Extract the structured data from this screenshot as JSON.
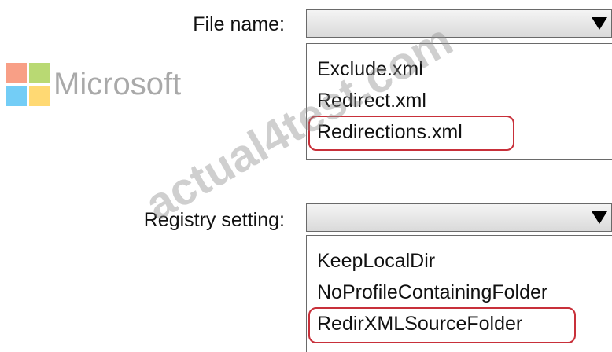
{
  "watermark": {
    "brand": "Microsoft",
    "site": "actual4test.com",
    "logo_colors": [
      "#f25022",
      "#7fba00",
      "#00a4ef",
      "#ffb900"
    ]
  },
  "file_name": {
    "label": "File name:",
    "selected_value": "",
    "arrow_icon": "triangle-down",
    "options": [
      "Exclude.xml",
      "Redirect.xml",
      "Redirections.xml"
    ],
    "highlighted_option": "Redirections.xml"
  },
  "registry_setting": {
    "label": "Registry setting:",
    "selected_value": "",
    "arrow_icon": "triangle-down",
    "options": [
      "KeepLocalDir",
      "NoProfileContainingFolder",
      "RedirXMLSourceFolder"
    ],
    "highlighted_option": "RedirXMLSourceFolder"
  },
  "colors": {
    "highlight_border": "#c8303a",
    "dropdown_border": "#6a6a6a"
  }
}
